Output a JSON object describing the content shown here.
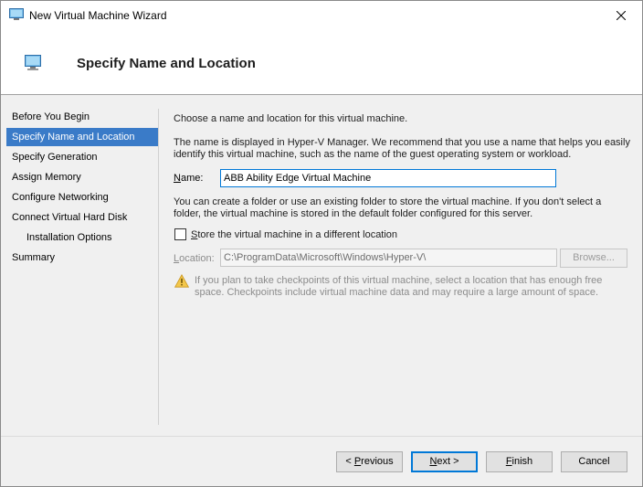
{
  "window": {
    "title": "New Virtual Machine Wizard",
    "close_icon": "close-icon"
  },
  "header": {
    "title": "Specify Name and Location",
    "icon": "virtual-machine-icon"
  },
  "nav": {
    "items": [
      {
        "label": "Before You Begin",
        "active": false,
        "sub": false
      },
      {
        "label": "Specify Name and Location",
        "active": true,
        "sub": false
      },
      {
        "label": "Specify Generation",
        "active": false,
        "sub": false
      },
      {
        "label": "Assign Memory",
        "active": false,
        "sub": false
      },
      {
        "label": "Configure Networking",
        "active": false,
        "sub": false
      },
      {
        "label": "Connect Virtual Hard Disk",
        "active": false,
        "sub": false
      },
      {
        "label": "Installation Options",
        "active": false,
        "sub": true
      },
      {
        "label": "Summary",
        "active": false,
        "sub": false
      }
    ]
  },
  "main": {
    "intro": "Choose a name and location for this virtual machine.",
    "name_desc": "The name is displayed in Hyper-V Manager. We recommend that you use a name that helps you easily identify this virtual machine, such as the name of the guest operating system or workload.",
    "name_label_prefix": "N",
    "name_label_rest": "ame:",
    "name_value": "ABB Ability Edge Virtual Machine",
    "folder_desc": "You can create a folder or use an existing folder to store the virtual machine. If you don't select a folder, the virtual machine is stored in the default folder configured for this server.",
    "store_checkbox_prefix": "S",
    "store_checkbox_rest": "tore the virtual machine in a different location",
    "store_checked": false,
    "location_label_prefix": "L",
    "location_label_rest": "ocation:",
    "location_value": "C:\\ProgramData\\Microsoft\\Windows\\Hyper-V\\",
    "browse_label": "Browse...",
    "warning_text": "If you plan to take checkpoints of this virtual machine, select a location that has enough free space. Checkpoints include virtual machine data and may require a large amount of space."
  },
  "footer": {
    "previous_prefix": "< ",
    "previous_accel": "P",
    "previous_rest": "revious",
    "next_accel": "N",
    "next_rest": "ext >",
    "finish_accel": "F",
    "finish_rest": "inish",
    "cancel_label": "Cancel"
  },
  "colors": {
    "accent": "#0078d7",
    "nav_active": "#3a7bc8",
    "warning": "#e8a317"
  }
}
